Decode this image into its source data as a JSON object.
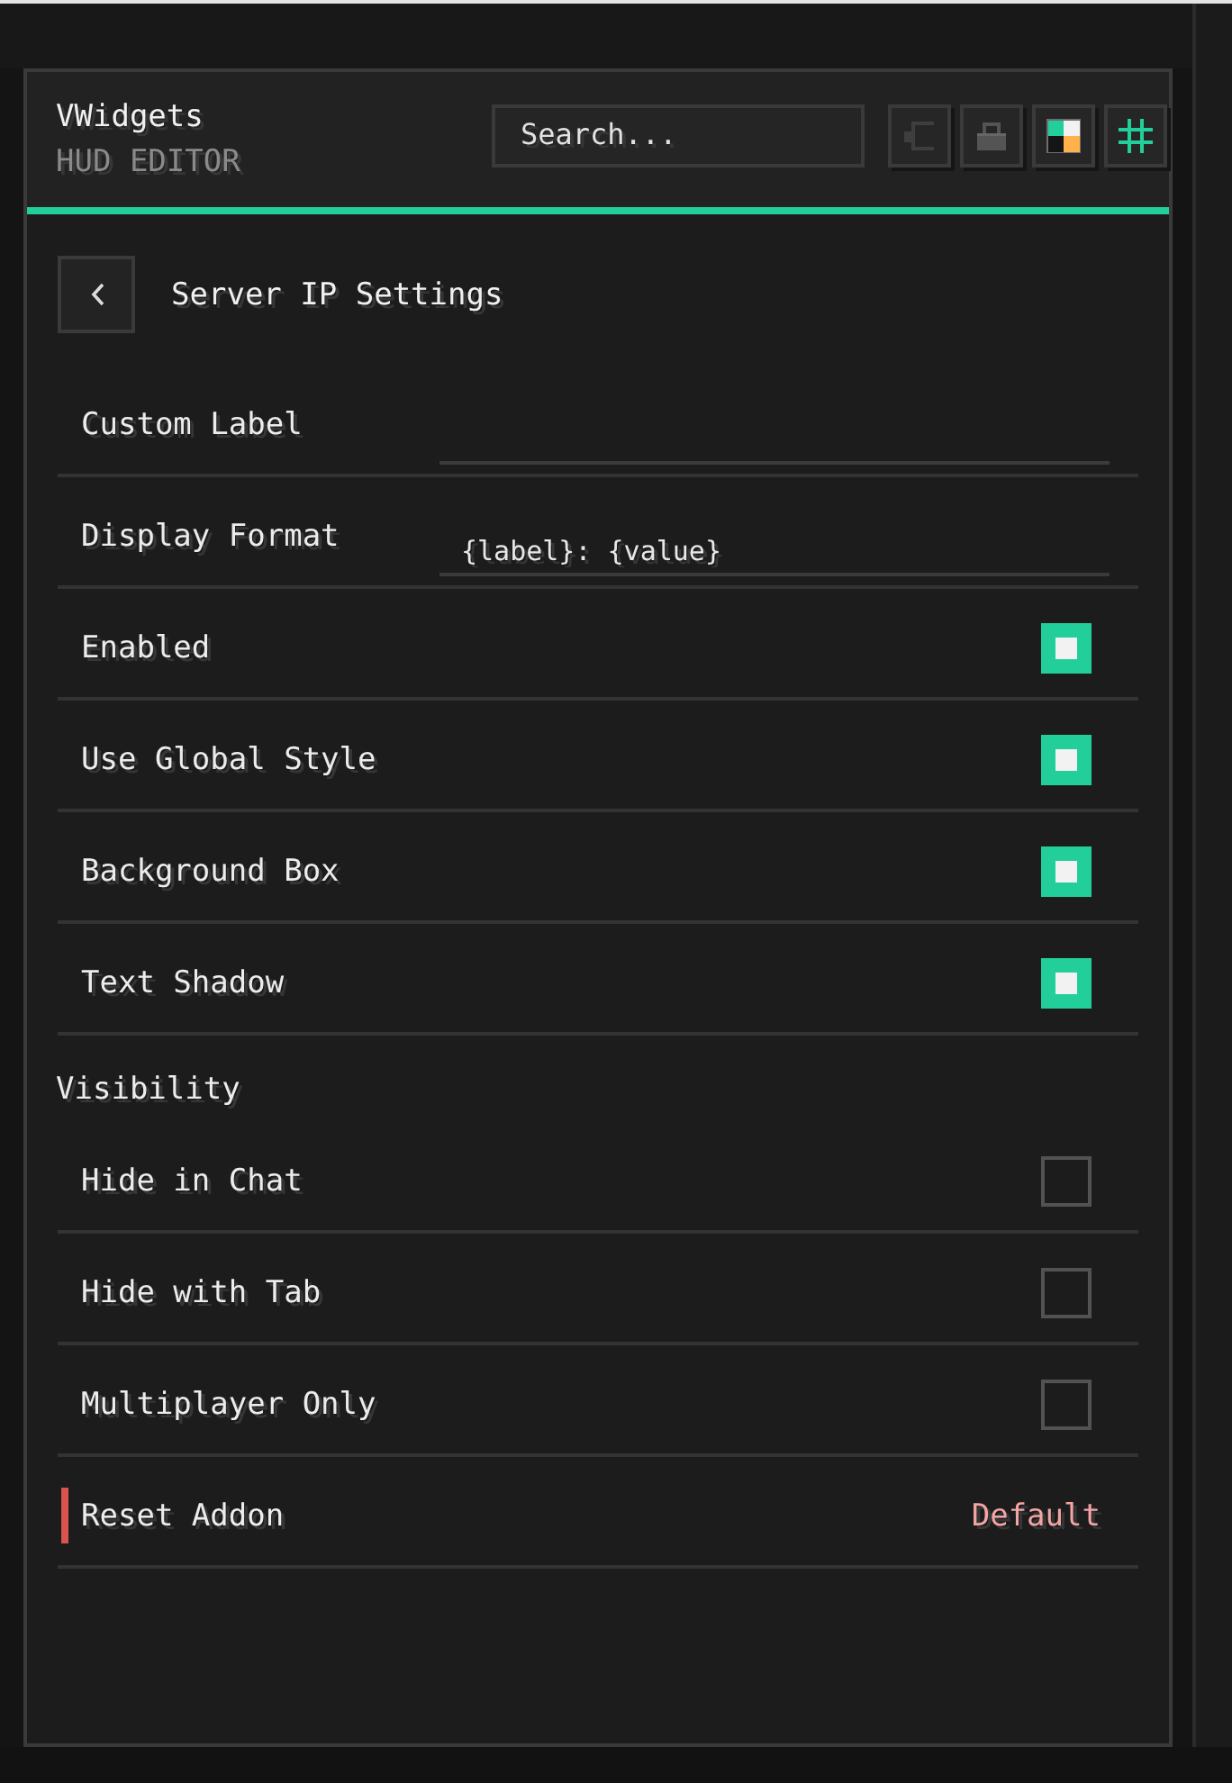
{
  "header": {
    "title": "VWidgets",
    "subtitle": "HUD EDITOR",
    "search": {
      "placeholder": "Search..."
    },
    "toolbar": [
      {
        "kind": "snap",
        "on": false
      },
      {
        "kind": "lock",
        "on": false
      },
      {
        "kind": "palette",
        "on": true
      },
      {
        "kind": "grid",
        "on": true
      }
    ]
  },
  "page": {
    "title": "Server IP Settings"
  },
  "settings": [
    {
      "kind": "text",
      "label": "Custom Label"
    },
    {
      "kind": "text",
      "label": "Display Format",
      "value": "{label}: {value}"
    },
    {
      "kind": "toggle",
      "label": "Enabled",
      "checked": true
    },
    {
      "kind": "toggle",
      "label": "Use Global Style",
      "checked": true
    },
    {
      "kind": "toggle",
      "label": "Background Box",
      "checked": true
    },
    {
      "kind": "toggle",
      "label": "Text Shadow",
      "checked": true
    },
    {
      "kind": "heading",
      "label": "Visibility"
    },
    {
      "kind": "toggle",
      "label": "Hide in Chat",
      "checked": false
    },
    {
      "kind": "toggle",
      "label": "Hide with Tab",
      "checked": false
    },
    {
      "kind": "toggle",
      "label": "Multiplayer Only",
      "checked": false
    },
    {
      "kind": "reset",
      "label": "Reset Addon",
      "value": "Default"
    }
  ]
}
